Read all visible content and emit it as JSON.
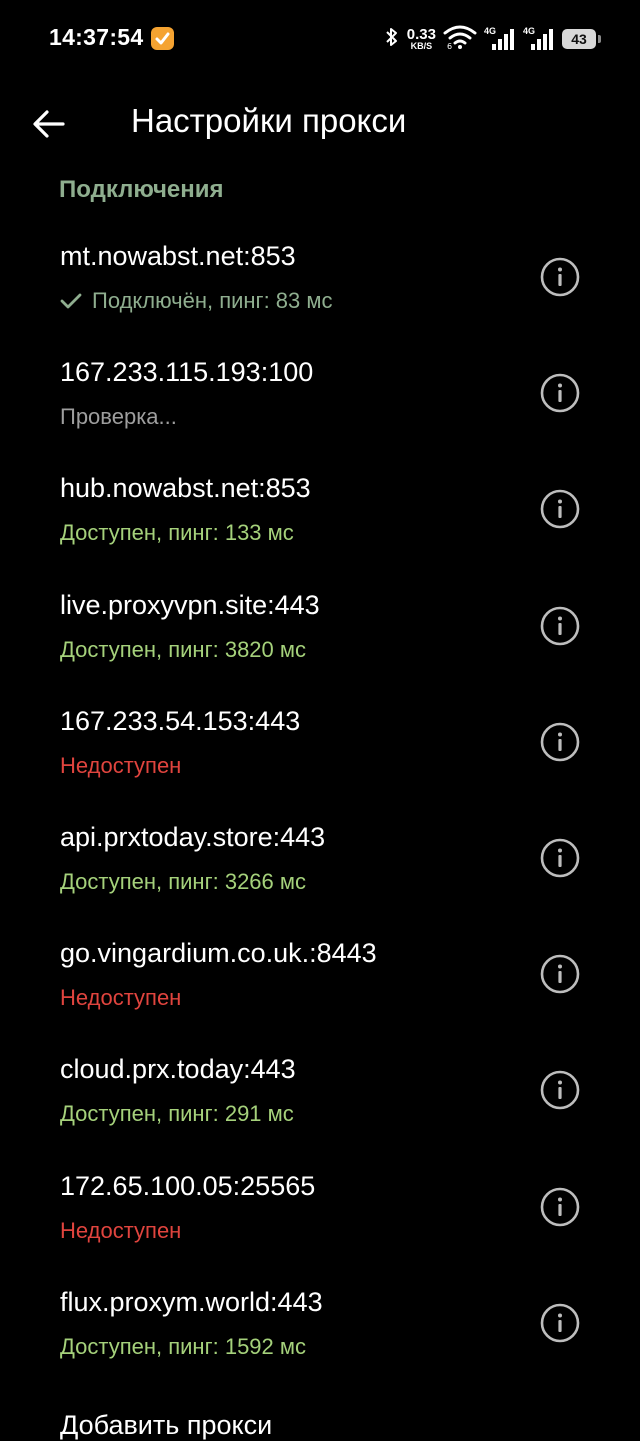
{
  "status_bar": {
    "time": "14:37:54",
    "net_speed_value": "0.33",
    "net_speed_unit": "KB/S",
    "net_type_1": "4G",
    "net_type_2": "4G",
    "battery": "43"
  },
  "header": {
    "title": "Настройки прокси"
  },
  "section": {
    "title": "Подключения"
  },
  "colors": {
    "background": "#000000",
    "section": "#8fae8f",
    "connected": "#8fae8f",
    "checking": "#9e9e9e",
    "available": "#a5d17b",
    "unavailable": "#e0443e",
    "icon": "#bdbdbd"
  },
  "proxies": [
    {
      "address": "mt.nowabst.net:853",
      "status_text": "Подключён, пинг: 83 мс",
      "status": "connected"
    },
    {
      "address": "167.233.115.193:100",
      "status_text": "Проверка...",
      "status": "checking"
    },
    {
      "address": "hub.nowabst.net:853",
      "status_text": "Доступен, пинг: 133 мс",
      "status": "available"
    },
    {
      "address": "live.proxyvpn.site:443",
      "status_text": "Доступен, пинг: 3820 мс",
      "status": "available"
    },
    {
      "address": "167.233.54.153:443",
      "status_text": "Недоступен",
      "status": "unavailable"
    },
    {
      "address": "api.prxtoday.store:443",
      "status_text": "Доступен, пинг: 3266 мс",
      "status": "available"
    },
    {
      "address": "go.vingardium.co.uk.:8443",
      "status_text": "Недоступен",
      "status": "unavailable"
    },
    {
      "address": "cloud.prx.today:443",
      "status_text": "Доступен, пинг: 291 мс",
      "status": "available"
    },
    {
      "address": "172.65.100.05:25565",
      "status_text": "Недоступен",
      "status": "unavailable"
    },
    {
      "address": "flux.proxym.world:443",
      "status_text": "Доступен, пинг: 1592 мс",
      "status": "available"
    }
  ],
  "add_proxy_label": "Добавить прокси"
}
